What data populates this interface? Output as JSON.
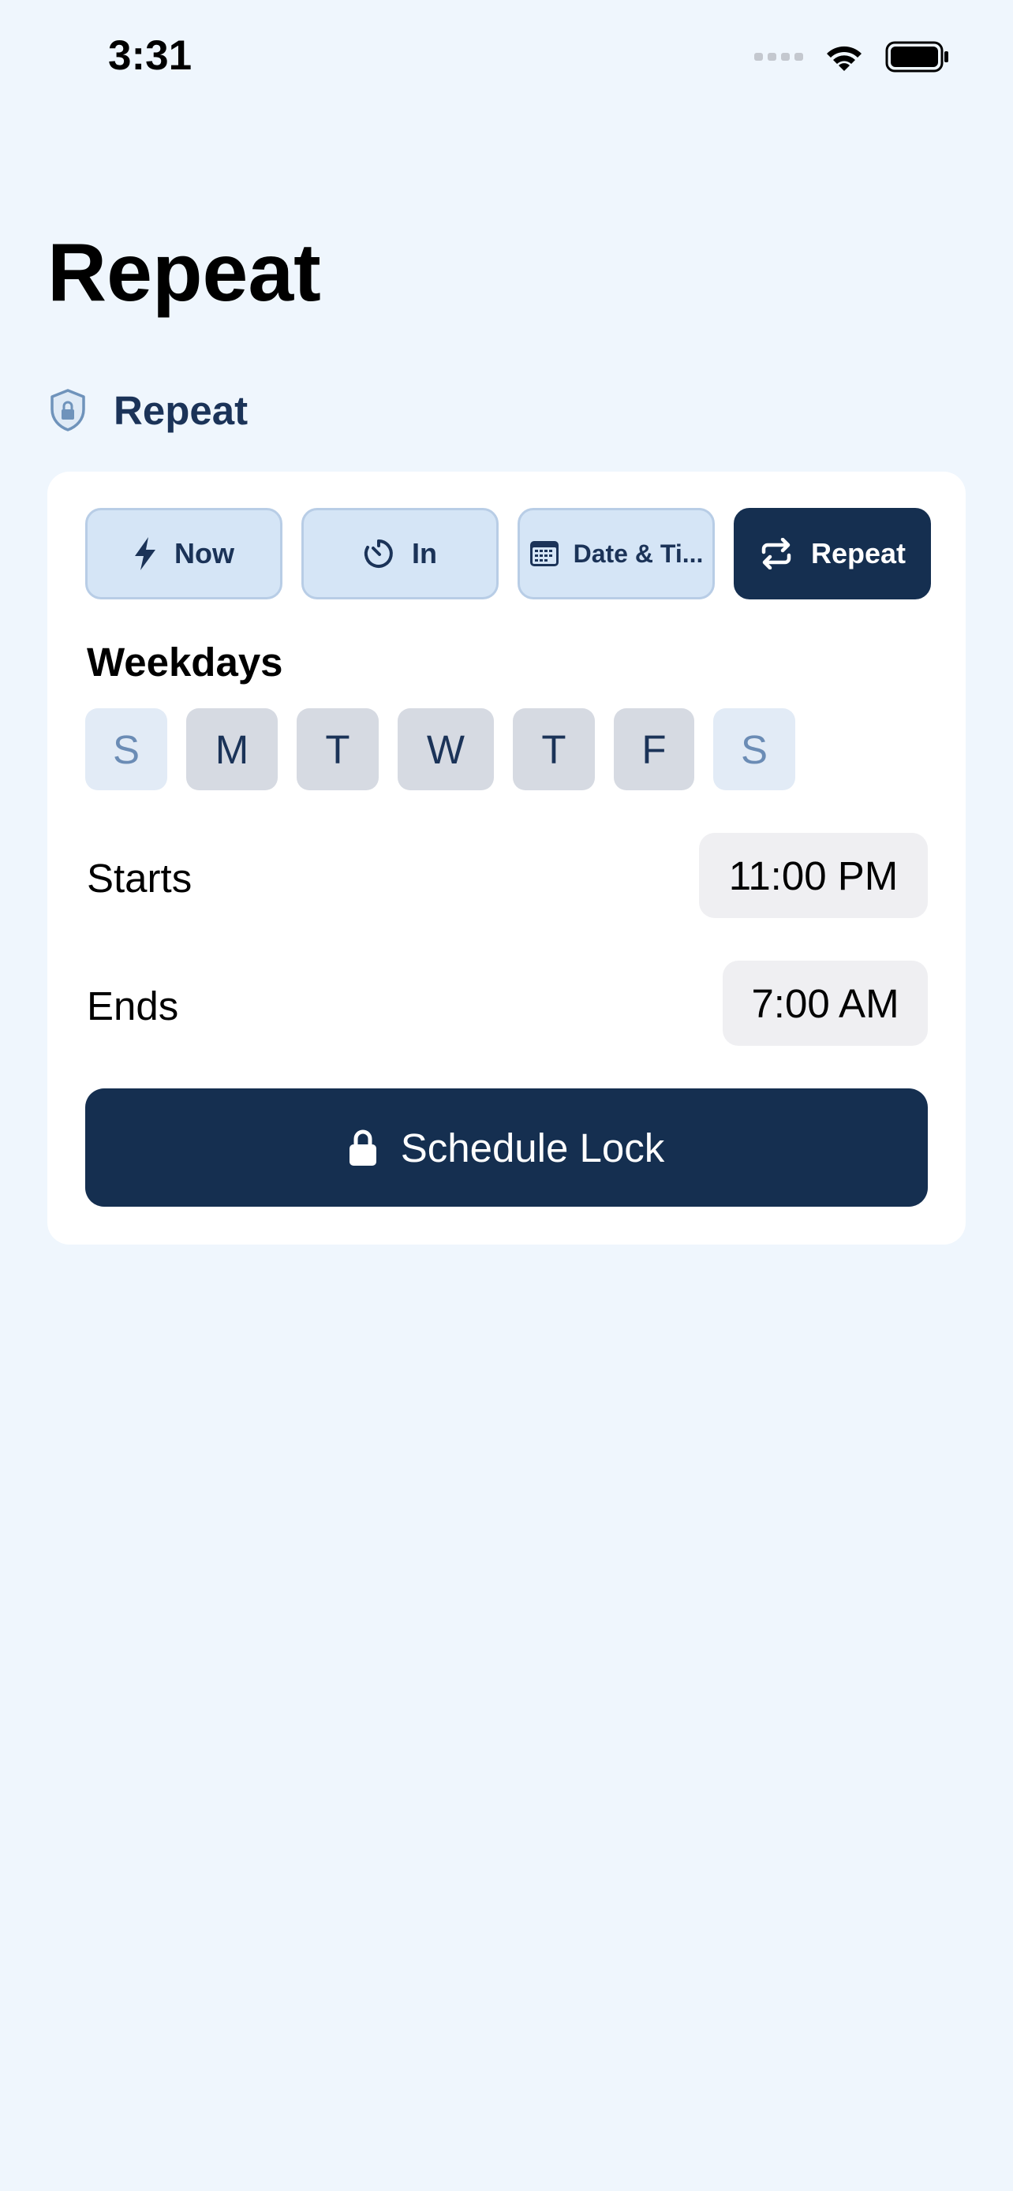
{
  "status_bar": {
    "time": "3:31",
    "signal_icon": "cellular-dots-icon",
    "wifi_icon": "wifi-icon",
    "battery_icon": "battery-icon"
  },
  "page": {
    "title": "Repeat"
  },
  "section": {
    "icon": "shield-lock-icon",
    "label": "Repeat"
  },
  "modes": [
    {
      "label": "Now",
      "icon": "bolt-icon",
      "active": false
    },
    {
      "label": "In",
      "icon": "timer-icon",
      "active": false
    },
    {
      "label": "Date & Ti...",
      "icon": "calendar-icon",
      "active": false
    },
    {
      "label": "Repeat",
      "icon": "repeat-icon",
      "active": true
    }
  ],
  "weekdays": {
    "label": "Weekdays",
    "days": [
      {
        "letter": "S",
        "selected": false
      },
      {
        "letter": "M",
        "selected": true
      },
      {
        "letter": "T",
        "selected": true
      },
      {
        "letter": "W",
        "selected": true
      },
      {
        "letter": "T",
        "selected": true
      },
      {
        "letter": "F",
        "selected": true
      },
      {
        "letter": "S",
        "selected": false
      }
    ]
  },
  "starts": {
    "label": "Starts",
    "value": "11:00 PM"
  },
  "ends": {
    "label": "Ends",
    "value": "7:00 AM"
  },
  "schedule_button": {
    "label": "Schedule Lock",
    "icon": "lock-icon"
  },
  "colors": {
    "background": "#eff6fd",
    "navy": "#152f50",
    "mode_button_bg": "#d5e5f6",
    "day_selected_bg": "#d6dae2",
    "day_unselected_bg": "#e2ebf6"
  }
}
